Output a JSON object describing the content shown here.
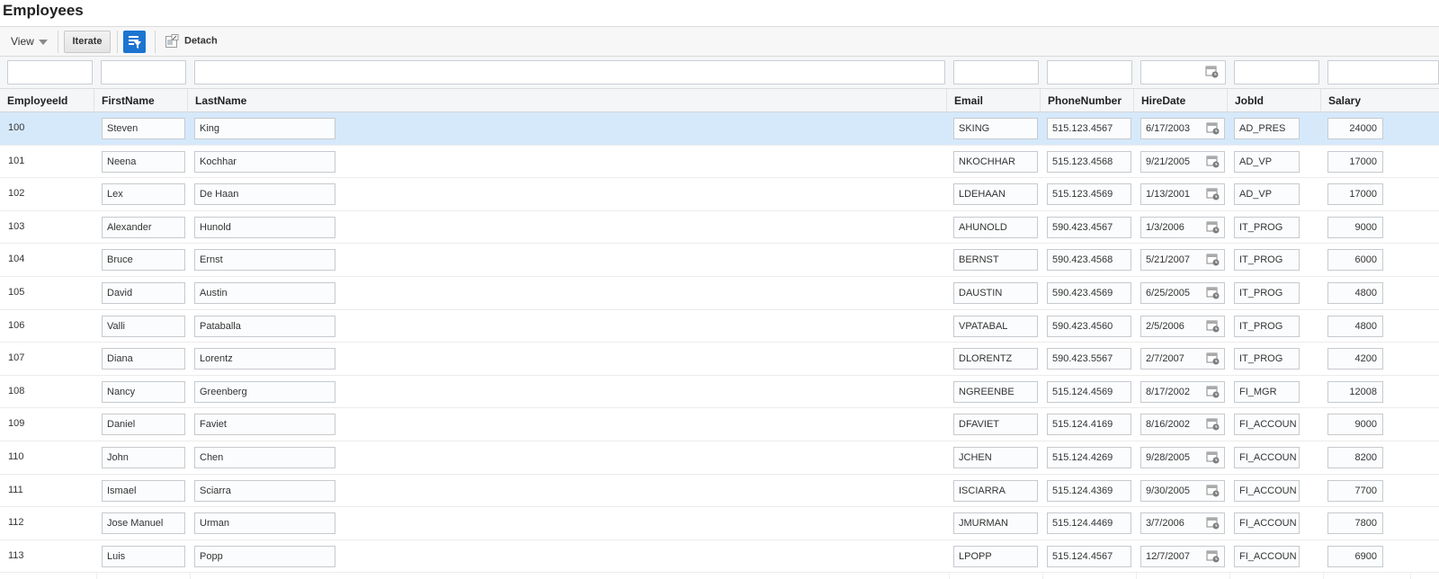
{
  "page": {
    "title": "Employees"
  },
  "toolbar": {
    "view_label": "View",
    "iterate_label": "Iterate",
    "detach_label": "Detach",
    "accent_color": "#1b74d1"
  },
  "columns": [
    {
      "key": "EmployeeId",
      "label": "EmployeeId"
    },
    {
      "key": "FirstName",
      "label": "FirstName"
    },
    {
      "key": "LastName",
      "label": "LastName"
    },
    {
      "key": "Email",
      "label": "Email"
    },
    {
      "key": "PhoneNumber",
      "label": "PhoneNumber"
    },
    {
      "key": "HireDate",
      "label": "HireDate"
    },
    {
      "key": "JobId",
      "label": "JobId"
    },
    {
      "key": "Salary",
      "label": "Salary"
    }
  ],
  "rows": [
    {
      "id": "100",
      "first": "Steven",
      "last": "King",
      "email": "SKING",
      "phone": "515.123.4567",
      "hire": "6/17/2003",
      "job": "AD_PRES",
      "salary": "24000",
      "selected": true
    },
    {
      "id": "101",
      "first": "Neena",
      "last": "Kochhar",
      "email": "NKOCHHAR",
      "phone": "515.123.4568",
      "hire": "9/21/2005",
      "job": "AD_VP",
      "salary": "17000"
    },
    {
      "id": "102",
      "first": "Lex",
      "last": "De Haan",
      "email": "LDEHAAN",
      "phone": "515.123.4569",
      "hire": "1/13/2001",
      "job": "AD_VP",
      "salary": "17000"
    },
    {
      "id": "103",
      "first": "Alexander",
      "last": "Hunold",
      "email": "AHUNOLD",
      "phone": "590.423.4567",
      "hire": "1/3/2006",
      "job": "IT_PROG",
      "salary": "9000"
    },
    {
      "id": "104",
      "first": "Bruce",
      "last": "Ernst",
      "email": "BERNST",
      "phone": "590.423.4568",
      "hire": "5/21/2007",
      "job": "IT_PROG",
      "salary": "6000"
    },
    {
      "id": "105",
      "first": "David",
      "last": "Austin",
      "email": "DAUSTIN",
      "phone": "590.423.4569",
      "hire": "6/25/2005",
      "job": "IT_PROG",
      "salary": "4800"
    },
    {
      "id": "106",
      "first": "Valli",
      "last": "Pataballa",
      "email": "VPATABAL",
      "phone": "590.423.4560",
      "hire": "2/5/2006",
      "job": "IT_PROG",
      "salary": "4800"
    },
    {
      "id": "107",
      "first": "Diana",
      "last": "Lorentz",
      "email": "DLORENTZ",
      "phone": "590.423.5567",
      "hire": "2/7/2007",
      "job": "IT_PROG",
      "salary": "4200"
    },
    {
      "id": "108",
      "first": "Nancy",
      "last": "Greenberg",
      "email": "NGREENBE",
      "phone": "515.124.4569",
      "hire": "8/17/2002",
      "job": "FI_MGR",
      "salary": "12008"
    },
    {
      "id": "109",
      "first": "Daniel",
      "last": "Faviet",
      "email": "DFAVIET",
      "phone": "515.124.4169",
      "hire": "8/16/2002",
      "job": "FI_ACCOUN",
      "salary": "9000"
    },
    {
      "id": "110",
      "first": "John",
      "last": "Chen",
      "email": "JCHEN",
      "phone": "515.124.4269",
      "hire": "9/28/2005",
      "job": "FI_ACCOUN",
      "salary": "8200"
    },
    {
      "id": "111",
      "first": "Ismael",
      "last": "Sciarra",
      "email": "ISCIARRA",
      "phone": "515.124.4369",
      "hire": "9/30/2005",
      "job": "FI_ACCOUN",
      "salary": "7700"
    },
    {
      "id": "112",
      "first": "Jose Manuel",
      "last": "Urman",
      "email": "JMURMAN",
      "phone": "515.124.4469",
      "hire": "3/7/2006",
      "job": "FI_ACCOUN",
      "salary": "7800"
    },
    {
      "id": "113",
      "first": "Luis",
      "last": "Popp",
      "email": "LPOPP",
      "phone": "515.124.4567",
      "hire": "12/7/2007",
      "job": "FI_ACCOUN",
      "salary": "6900"
    }
  ]
}
